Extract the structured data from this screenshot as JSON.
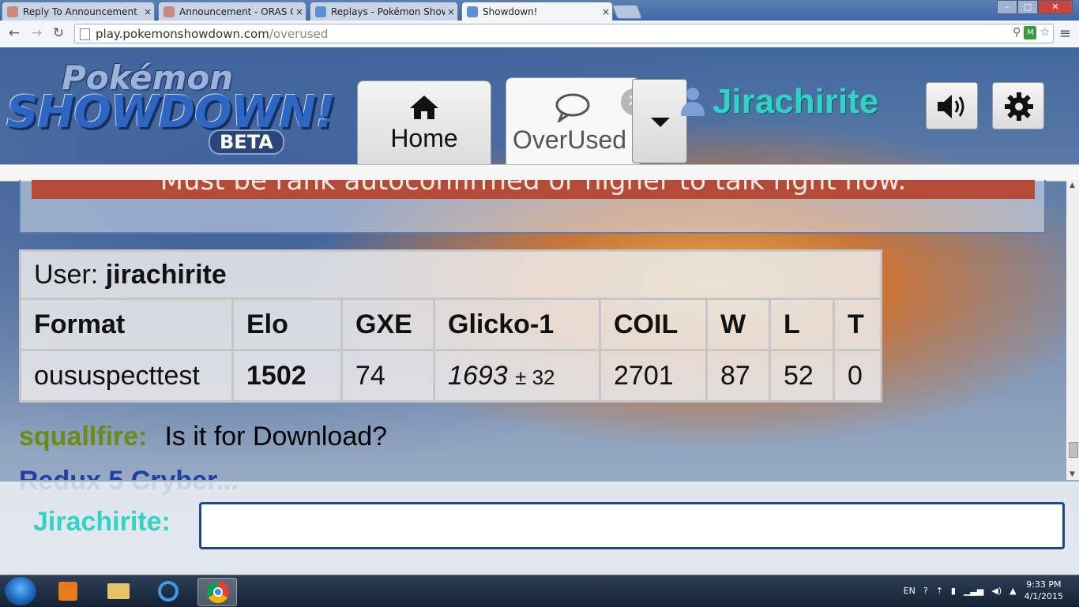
{
  "browser": {
    "tabs": [
      {
        "title": "Reply To Announcement",
        "close": "×",
        "fav": "#c98a7e"
      },
      {
        "title": "Announcement - ORAS O",
        "close": "×",
        "fav": "#c98a7e"
      },
      {
        "title": "Replays - Pokémon Showd",
        "close": "×",
        "fav": "#5b8fd6"
      },
      {
        "title": "Showdown!",
        "close": "×",
        "fav": "#5b8fd6"
      }
    ],
    "url_host": "play.pokemonshowdown.com",
    "url_path": "/overused",
    "win_min": "–",
    "win_max": "□",
    "win_close": "✕"
  },
  "header": {
    "logo_line1": "Pokémon",
    "logo_line2": "SHOWDOWN!",
    "logo_line3": "BETA",
    "tabs": [
      {
        "label": "Home",
        "icon": "home-icon"
      },
      {
        "label": "OverUsed",
        "icon": "chat-bubble-icon"
      }
    ],
    "username": "Jirachirite"
  },
  "notice_text": "Must be rank autoconfirmed or higher to talk right now.",
  "rank_table": {
    "user_label": "User:",
    "user_name": "jirachirite",
    "headers": [
      "Format",
      "Elo",
      "GXE",
      "Glicko-1",
      "COIL",
      "W",
      "L",
      "T"
    ],
    "row": {
      "format": "oususpecttest",
      "elo": "1502",
      "gxe": "74",
      "glicko": "1693",
      "glicko_pm": "± 32",
      "coil": "2701",
      "w": "87",
      "l": "52",
      "t": "0"
    }
  },
  "chat": [
    {
      "user": "squallfire:",
      "message": "Is it for Download?"
    }
  ],
  "chat_partial": "Redux 5 Cryber...",
  "compose": {
    "label": "Jirachirite:",
    "value": ""
  },
  "taskbar": {
    "lang": "EN",
    "time": "9:33 PM",
    "date": "4/1/2015"
  }
}
